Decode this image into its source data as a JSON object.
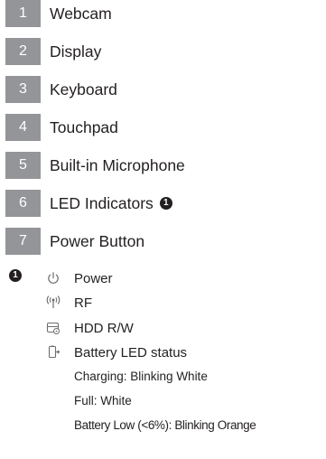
{
  "legend_items": [
    {
      "number": "1",
      "label": "Webcam"
    },
    {
      "number": "2",
      "label": "Display"
    },
    {
      "number": "3",
      "label": "Keyboard"
    },
    {
      "number": "4",
      "label": "Touchpad"
    },
    {
      "number": "5",
      "label": "Built-in Microphone"
    },
    {
      "number": "6",
      "label": "LED Indicators"
    },
    {
      "number": "7",
      "label": "Power Button"
    }
  ],
  "footnote_marker": "1",
  "indicators": [
    {
      "icon": "power-icon",
      "label": "Power"
    },
    {
      "icon": "rf-antenna-icon",
      "label": "RF"
    },
    {
      "icon": "hdd-icon",
      "label": "HDD R/W"
    },
    {
      "icon": "battery-icon",
      "label": "Battery LED status"
    }
  ],
  "battery_status": [
    "Charging: Blinking White",
    "Full: White",
    "Battery Low (<6%): Blinking Orange"
  ],
  "colors": {
    "number_box": "#939598",
    "text": "#231f20",
    "icon": "#6d6e71"
  }
}
